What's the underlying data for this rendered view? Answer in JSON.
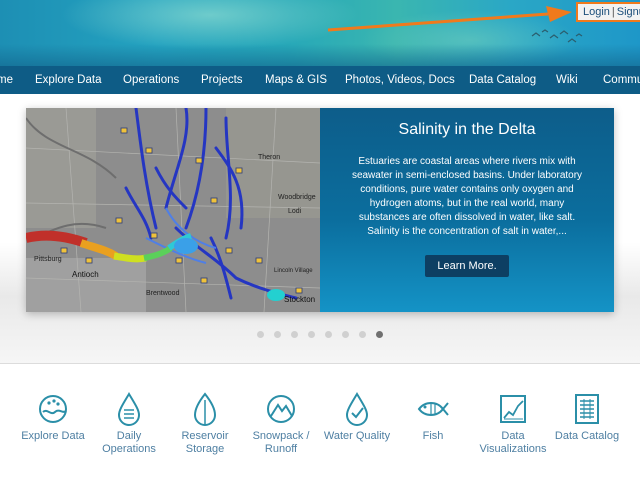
{
  "header": {
    "login_label": "Login",
    "signup_label": "Signu",
    "separator": "|"
  },
  "nav": {
    "items": [
      "me",
      "Explore Data",
      "Operations",
      "Projects",
      "Maps & GIS",
      "Photos, Videos, Docs",
      "Data Catalog",
      "Wiki",
      "Commu"
    ]
  },
  "hero": {
    "map_labels": [
      "Theron",
      "Woodbridge",
      "Lodi",
      "Stockton",
      "Antioch",
      "Pittsburg",
      "Lincoln Village",
      "Brentwood"
    ],
    "title": "Salinity in the Delta",
    "body": "Estuaries are coastal areas where rivers mix with seawater in semi-enclosed basins. Under laboratory conditions, pure water contains only oxygen and hydrogen atoms, but in the real world, many substances are often dissolved in water, like salt. Salinity is the concentration of salt in water,...",
    "button_label": "Learn More.",
    "slide_count": 8,
    "active_slide": 8
  },
  "quick_links": [
    {
      "label": "Explore Data",
      "icon": "globe-icon"
    },
    {
      "label": "Daily Operations",
      "icon": "water-drop-icon"
    },
    {
      "label": "Reservoir Storage",
      "icon": "leaf-icon"
    },
    {
      "label": "Snowpack / Runoff",
      "icon": "mountain-icon"
    },
    {
      "label": "Water Quality",
      "icon": "check-drop-icon"
    },
    {
      "label": "Fish",
      "icon": "fish-icon"
    },
    {
      "label": "Data Visualizations",
      "icon": "chart-icon"
    },
    {
      "label": "Data Catalog",
      "icon": "catalog-icon"
    }
  ],
  "colors": {
    "nav_bg": "#0e5c86",
    "accent_orange": "#f07a1c",
    "panel_blue": "#0b6e9e",
    "link_blue": "#4e7fa2",
    "icon_teal": "#2b8fa8"
  }
}
